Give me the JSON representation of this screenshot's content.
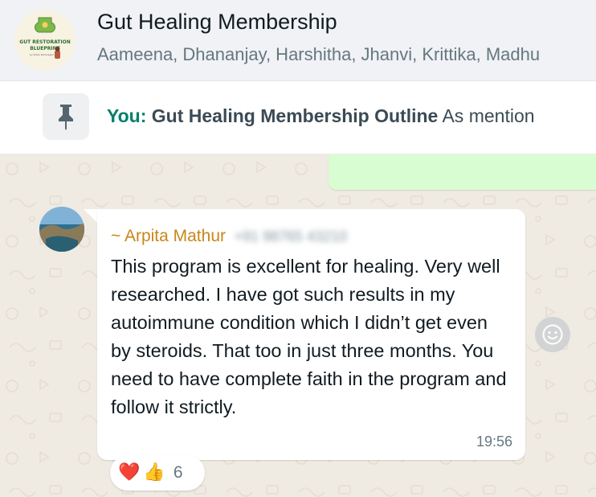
{
  "header": {
    "avatar_logo": {
      "line1": "GUT RESTORATION",
      "line2": "BLUEPRINT",
      "byline": "by Shilpi Ramnagari"
    },
    "title": "Gut Healing Membership",
    "members": "Aameena, Dhananjay, Harshitha, Jhanvi, Krittika, Madhu"
  },
  "pinned": {
    "icon": "pin-icon",
    "sender": "You:",
    "title": "Gut Healing Membership Outline",
    "preview": "As mention"
  },
  "message": {
    "sender_name": "~ Arpita Mathur",
    "sender_phone": "+91 98765 43210",
    "body": "This program is excellent for healing. Very well researched. I have got such results in my autoimmune condition which I didn’t get even by steroids. That too in just three months. You need to have complete faith in the program and follow it strictly.",
    "time": "19:56"
  },
  "reactions": {
    "emojis": [
      "❤️",
      "👍"
    ],
    "count": "6"
  },
  "icons": {
    "reaction_button": "smiley-icon"
  },
  "colors": {
    "accent_green": "#008069",
    "sender_gold": "#c88719",
    "outgoing_bubble": "#d9fdd3",
    "chat_background": "#efeae2"
  }
}
